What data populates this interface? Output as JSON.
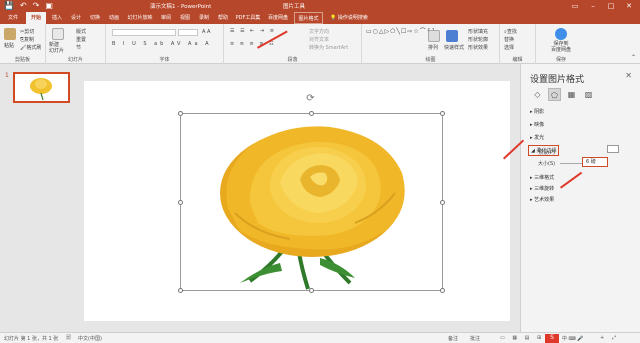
{
  "titlebar": {
    "doc_title": "演示文稿1 - PowerPoint",
    "context_title": "图片工具",
    "qat": [
      "save-icon",
      "undo-icon",
      "redo-icon",
      "present-icon"
    ]
  },
  "tabs": [
    "文件",
    "开始",
    "插入",
    "设计",
    "切换",
    "动画",
    "幻灯片放映",
    "审阅",
    "视图",
    "录制",
    "帮助",
    "PDF工具集",
    "百度网盘",
    "图片格式"
  ],
  "tell_me": "操作说明搜索",
  "ribbon": {
    "clipboard": {
      "paste": "粘贴",
      "cut": "剪切",
      "copy": "复制",
      "format_painter": "格式刷",
      "label": "剪贴板"
    },
    "slides": {
      "new_slide": "新建\n幻灯片",
      "layout": "版式",
      "reset": "重置",
      "section": "节",
      "label": "幻灯片"
    },
    "font": {
      "label": "字体"
    },
    "paragraph": {
      "label": "段落",
      "text_direction": "文字方向",
      "align_text": "对齐文本",
      "smartart": "转换为 SmartArt"
    },
    "drawing": {
      "arrange": "排列",
      "quick_styles": "快速样式",
      "shape_fill": "形状填充",
      "shape_outline": "形状轮廓",
      "shape_effects": "形状效果",
      "label": "绘图"
    },
    "editing": {
      "find": "查找",
      "replace": "替换",
      "select": "选择",
      "label": "编辑"
    },
    "baidu": {
      "save": "保存到\n百度网盘",
      "label": "保存"
    }
  },
  "thumbs": {
    "number": "1"
  },
  "pane": {
    "title": "设置图片格式",
    "sections": [
      "阴影",
      "映像",
      "发光",
      "柔化边缘",
      "三维格式",
      "三维旋转",
      "艺术效果"
    ],
    "preset_label": "预设(P)",
    "size_label": "大小(S)",
    "size_value": "6 磅"
  },
  "statusbar": {
    "slide_info": "幻灯片 第 1 张，共 1 张",
    "language": "中文(中国)",
    "notes": "备注",
    "comments": "批注",
    "zoom": "+"
  }
}
